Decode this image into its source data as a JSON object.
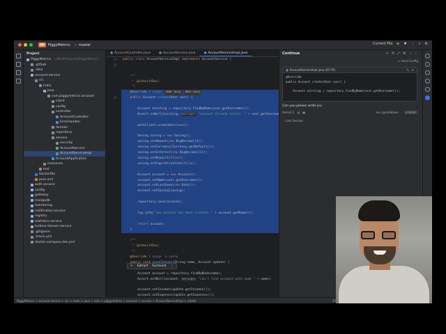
{
  "window": {
    "project_badge": "PM",
    "project_name": "PiggyMetrics",
    "branch": "master",
    "current_file": "Current File"
  },
  "project_panel": {
    "title": "Project",
    "items": [
      {
        "label": "PiggyMetrics",
        "hint": "~/WorkProjects/PiggyMetrics",
        "indent": 0,
        "color": "#8fb1e8"
      },
      {
        "label": ".github",
        "indent": 1,
        "color": "#8a8e96"
      },
      {
        "label": ".idea",
        "indent": 1,
        "color": "#8a8e96"
      },
      {
        "label": "account-service",
        "indent": 1,
        "color": "#8fb1e8"
      },
      {
        "label": "src",
        "indent": 2,
        "color": "#8a8e96"
      },
      {
        "label": "main",
        "indent": 3,
        "color": "#8a8e96"
      },
      {
        "label": "java",
        "indent": 4,
        "color": "#8fb1e8"
      },
      {
        "label": "com.piggymetrics.account",
        "indent": 5,
        "color": "#8a8e96"
      },
      {
        "label": "client",
        "indent": 6,
        "color": "#8a8e96"
      },
      {
        "label": "config",
        "indent": 6,
        "color": "#8a8e96"
      },
      {
        "label": "controller",
        "indent": 6,
        "color": "#8a8e96"
      },
      {
        "label": "AccountController",
        "indent": 7,
        "color": "#4f94d4"
      },
      {
        "label": "ErrorHandler",
        "indent": 7,
        "color": "#4f94d4"
      },
      {
        "label": "domain",
        "indent": 6,
        "color": "#8a8e96"
      },
      {
        "label": "repository",
        "indent": 6,
        "color": "#8a8e96"
      },
      {
        "label": "service",
        "indent": 6,
        "color": "#8a8e96"
      },
      {
        "label": "security",
        "indent": 7,
        "color": "#8a8e96"
      },
      {
        "label": "AccountService",
        "indent": 7,
        "color": "#6aab73"
      },
      {
        "label": "AccountServiceImpl",
        "indent": 7,
        "color": "#4f94d4",
        "selected": true
      },
      {
        "label": "AccountApplication",
        "indent": 6,
        "color": "#4f94d4"
      },
      {
        "label": "resources",
        "indent": 4,
        "color": "#8a8e96"
      },
      {
        "label": "test",
        "indent": 3,
        "color": "#8a8e96"
      },
      {
        "label": "Dockerfile",
        "indent": 2,
        "color": "#3574f0"
      },
      {
        "label": "pom.xml",
        "indent": 2,
        "color": "#d9743c"
      },
      {
        "label": "auth-service",
        "indent": 1,
        "color": "#8fb1e8"
      },
      {
        "label": "config",
        "indent": 1,
        "color": "#8fb1e8"
      },
      {
        "label": "gateway",
        "indent": 1,
        "color": "#8fb1e8"
      },
      {
        "label": "mongodb",
        "indent": 1,
        "color": "#8fb1e8"
      },
      {
        "label": "monitoring",
        "indent": 1,
        "color": "#8fb1e8"
      },
      {
        "label": "notification-service",
        "indent": 1,
        "color": "#8fb1e8"
      },
      {
        "label": "registry",
        "indent": 1,
        "color": "#8fb1e8"
      },
      {
        "label": "statistics-service",
        "indent": 1,
        "color": "#8fb1e8"
      },
      {
        "label": "turbine-stream-service",
        "indent": 1,
        "color": "#8fb1e8"
      },
      {
        "label": ".gitignore",
        "indent": 1,
        "color": "#8a8e96"
      },
      {
        "label": ".travis.yml",
        "indent": 1,
        "color": "#8a8e96"
      },
      {
        "label": "docker-compose.dev.yml",
        "indent": 1,
        "color": "#8a8e96"
      }
    ]
  },
  "editor": {
    "tabs": [
      "AccountController.java",
      "AccountService.java",
      "AccountServiceImpl.java"
    ],
    "active_tab": 2,
    "gutter": [
      "24",
      "25",
      "",
      "",
      "",
      "",
      "",
      "45",
      "",
      "",
      "",
      "",
      "",
      "",
      "",
      "",
      "",
      "",
      "",
      "",
      "",
      "",
      "",
      "",
      "",
      "",
      "",
      "",
      "",
      "",
      "",
      "",
      "",
      "",
      "",
      "",
      "",
      "",
      "",
      "",
      "",
      "",
      "",
      "",
      "",
      "",
      "",
      "",
      "",
      ""
    ],
    "lines": [
      {
        "html": "<span class=\"kw\">public class</span> AccountServiceImpl <span class=\"kw\">implements</span> AccountService {",
        "sel": false
      },
      {
        "html": "",
        "sel": false
      },
      {
        "html": "",
        "sel": false
      },
      {
        "html": "    <span class=\"cm\">/**</span>",
        "sel": false
      },
      {
        "html": "     <span class=\"cm\">* {<span class=\"an\">@inheritDoc</span>}</span>",
        "sel": false
      },
      {
        "html": "     <span class=\"cm\">*/</span>",
        "sel": false
      },
      {
        "html": "    <span class=\"an\">@Override</span> <span class=\"cm\">1 usage</span> <span class=\"chat-pill\">CHAT (⌘+J)</span><span class=\"chat-pill\">EDIT (⌘+I)</span>",
        "sel": true
      },
      {
        "html": "    <span class=\"kw\">public</span> Account <span class=\"fn\">create</span>(User user) {",
        "sel": true
      },
      {
        "html": "",
        "sel": true
      },
      {
        "html": "        Account existing = repository.findByName(user.getUsername());",
        "sel": true
      },
      {
        "html": "        Assert.isNull(existing, <span class=\"hint\">message:</span> <span class=\"str\">\"account already exists: \"</span> + user.getUsername",
        "sel": true
      },
      {
        "html": "",
        "sel": true
      },
      {
        "html": "        authClient.createUser(user);",
        "sel": true
      },
      {
        "html": "",
        "sel": true
      },
      {
        "html": "        Saving saving = <span class=\"kw\">new</span> Saving();",
        "sel": true
      },
      {
        "html": "        saving.setAmount(<span class=\"kw\">new</span> BigDecimal(<span class=\"fn\">0</span>));",
        "sel": true
      },
      {
        "html": "        saving.setCurrency(Currency.getDefault());",
        "sel": true
      },
      {
        "html": "        saving.setInterest(<span class=\"kw\">new</span> BigDecimal(<span class=\"fn\">0</span>));",
        "sel": true
      },
      {
        "html": "        saving.setDeposit(<span class=\"kw\">false</span>);",
        "sel": true
      },
      {
        "html": "        saving.setCapitalization(<span class=\"kw\">false</span>);",
        "sel": true
      },
      {
        "html": "",
        "sel": true
      },
      {
        "html": "        Account account = <span class=\"kw\">new</span> Account();",
        "sel": true
      },
      {
        "html": "        account.setName(user.getUsername());",
        "sel": true
      },
      {
        "html": "        account.setLastSeen(<span class=\"kw\">new</span> Date());",
        "sel": true
      },
      {
        "html": "        account.setSaving(saving);",
        "sel": true
      },
      {
        "html": "",
        "sel": true
      },
      {
        "html": "        repository.save(account);",
        "sel": true
      },
      {
        "html": "",
        "sel": true
      },
      {
        "html": "        log.info(<span class=\"str\">\"new account has been created: \"</span> + account.getName());",
        "sel": true
      },
      {
        "html": "",
        "sel": true
      },
      {
        "html": "        <span class=\"kw\">return</span> account;",
        "sel": true
      },
      {
        "html": "    }",
        "sel": true
      },
      {
        "html": "",
        "sel": false
      },
      {
        "html": "    <span class=\"cm\">/**</span>",
        "sel": false
      },
      {
        "html": "     <span class=\"cm\">* {<span class=\"an\">@inheritDoc</span>}</span>",
        "sel": false
      },
      {
        "html": "     <span class=\"cm\">*/</span>",
        "sel": false
      },
      {
        "html": "    <span class=\"an\">@Override</span> <span class=\"cm\">1 usage  ⊕ sqshq</span>",
        "sel": false
      },
      {
        "html": "    <span class=\"kw\">public void</span> <span class=\"fn\">saveChanges</span>(String name, Account update) {",
        "sel": false
      },
      {
        "html": "",
        "sel": false
      },
      {
        "html": "        Account account = repository.findByName(name);",
        "sel": false
      },
      {
        "html": "        Assert.notNull(account, <span class=\"hint\">message:</span> <span class=\"str\">\"can't find account with name \"</span> + name);",
        "sel": false
      },
      {
        "html": "",
        "sel": false
      },
      {
        "html": "        account.setIncomes(update.getIncomes());",
        "sel": false
      },
      {
        "html": "        account.setExpenses(update.getExpenses());",
        "sel": false
      },
      {
        "html": "        account.setSaving(update.getSaving());",
        "sel": false
      }
    ],
    "popup": {
      "extract": "Extract",
      "surround": "Surround"
    }
  },
  "continue_panel": {
    "title": "Continue",
    "local_config": "Local Config",
    "chat_file": "AccountServiceImpl.java (45-70)",
    "chat_code": "@Override\npublic Account create(User user) {\n\n    Account existing = repository.findByName(user.getUsername());",
    "ask_text": "Can you please write jvu",
    "model": "llama3.1",
    "codebase_hint": "⌘⏎ @codebase",
    "enter_label": "⏎ Enter",
    "last_session": "Last Session"
  },
  "statusbar": {
    "breadcrumb": "PiggyMetrics > account-service > src > main > java > com > piggymetrics > account > service > AccountServiceImpl > create",
    "position": "45:1 (657 chars, 25 line breaks)",
    "line_sep": "LF",
    "encoding": "UTF-8",
    "indent": "4 spaces"
  },
  "colors": {
    "accent": "#3574f0",
    "selection": "#214283",
    "project_badge": "#d9743c"
  }
}
